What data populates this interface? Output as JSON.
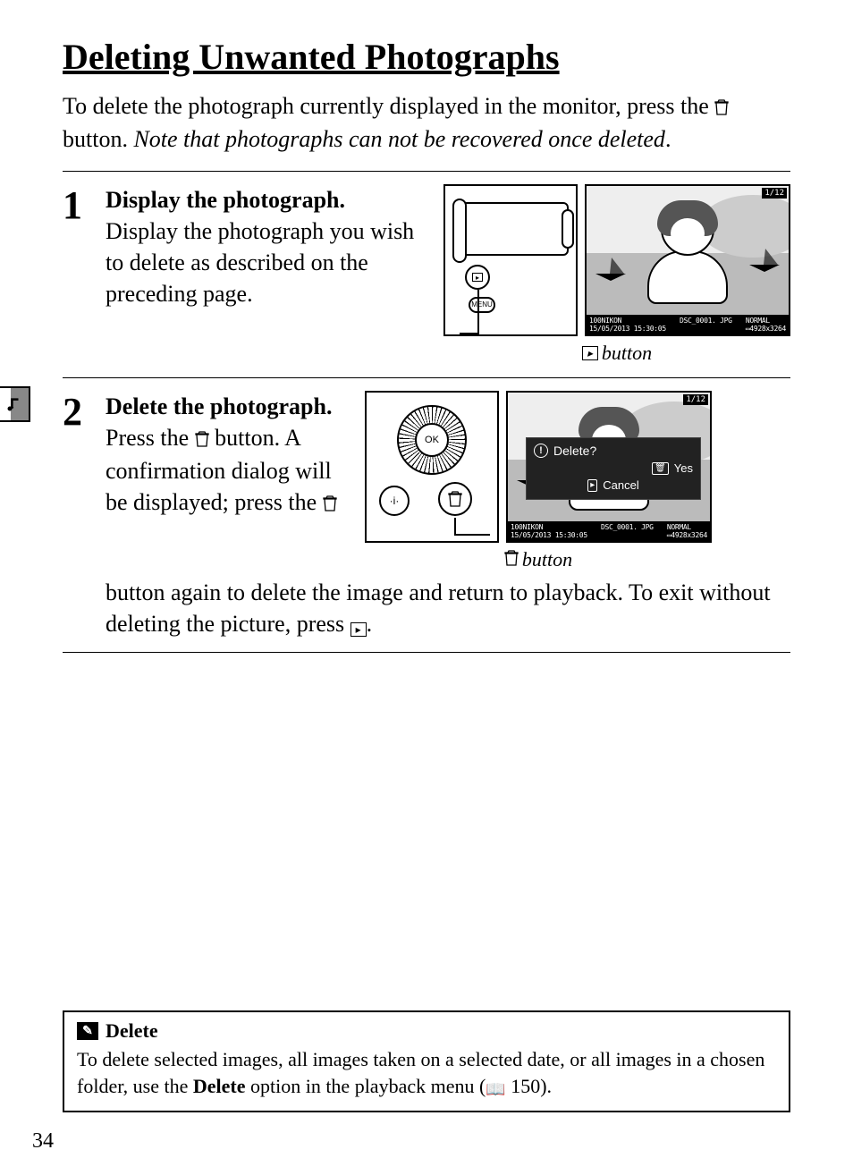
{
  "page": {
    "title": "Deleting Unwanted Photographs",
    "number": "34",
    "intro_prefix": "To delete the photograph currently displayed in the monitor, press the ",
    "intro_middle": " button.  ",
    "intro_note": "Note that photographs can not be recovered once deleted",
    "intro_suffix": "."
  },
  "steps": [
    {
      "num": "1",
      "title": "Display the photograph.",
      "body": "Display the photograph you wish to delete as described on the preceding page.",
      "caption_suffix": " button"
    },
    {
      "num": "2",
      "title": "Delete the photograph.",
      "body_a": "Press the ",
      "body_b": " button.  A confirmation dialog will be displayed; press the ",
      "body_c": " button again to delete the image and return to playback.  To exit without deleting the picture, press ",
      "body_d": ".",
      "caption_suffix": " button"
    }
  ],
  "lcd": {
    "counter": "1/12",
    "folder": "100NIKON",
    "date": "15/05/2013",
    "time": "15:30:05",
    "filename": "DSC_0001. JPG",
    "quality": "NORMAL",
    "dims": "4928x3264",
    "dialog": {
      "title": "Delete?",
      "yes": "Yes",
      "cancel": "Cancel"
    }
  },
  "cam": {
    "menu": "MENU",
    "ok": "OK",
    "i": "i"
  },
  "notebox": {
    "title": "Delete",
    "text_a": "To delete selected images, all images taken on a selected date, or all images in a chosen folder, use the ",
    "text_bold": "Delete",
    "text_b": " option in the playback menu (",
    "page_ref": " 150).",
    "book_glyph": "📖"
  },
  "icons": {
    "play_glyph": "▸",
    "trash_glyph": "🗑",
    "pencil_glyph": "✎"
  }
}
